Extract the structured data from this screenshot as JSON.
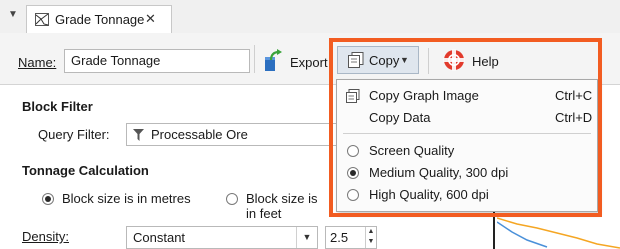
{
  "tab": {
    "title": "Grade Tonnage",
    "close": "✕",
    "menu_arrow": "▼"
  },
  "toolbar": {
    "name_label": "Name:",
    "name_value": "Grade Tonnage",
    "export_label": "Export",
    "copy_label": "Copy",
    "copy_caret": "▼",
    "help_label": "Help"
  },
  "form": {
    "block_filter_title": "Block Filter",
    "query_filter_label": "Query Filter:",
    "query_filter_value": "Processable Ore",
    "tonnage_title": "Tonnage Calculation",
    "radio_metres": "Block size is in metres",
    "radio_feet": "Block size is in feet",
    "radio_selected": "metres",
    "density_label": "Density:",
    "density_mode": "Constant",
    "density_value": "2.5"
  },
  "menu": {
    "items": [
      {
        "label": "Copy Graph Image",
        "shortcut": "Ctrl+C",
        "icon": "copy-image-icon"
      },
      {
        "label": "Copy Data",
        "shortcut": "Ctrl+D"
      }
    ],
    "quality": [
      {
        "label": "Screen Quality",
        "selected": false
      },
      {
        "label": "Medium Quality, 300 dpi",
        "selected": true
      },
      {
        "label": "High Quality, 600 dpi",
        "selected": false
      }
    ]
  },
  "colors": {
    "highlight": "#f25c21",
    "copy_active_bg": "#dfe6ee",
    "chart_line": "#f5a623",
    "chart_line2": "#4a90d9"
  }
}
